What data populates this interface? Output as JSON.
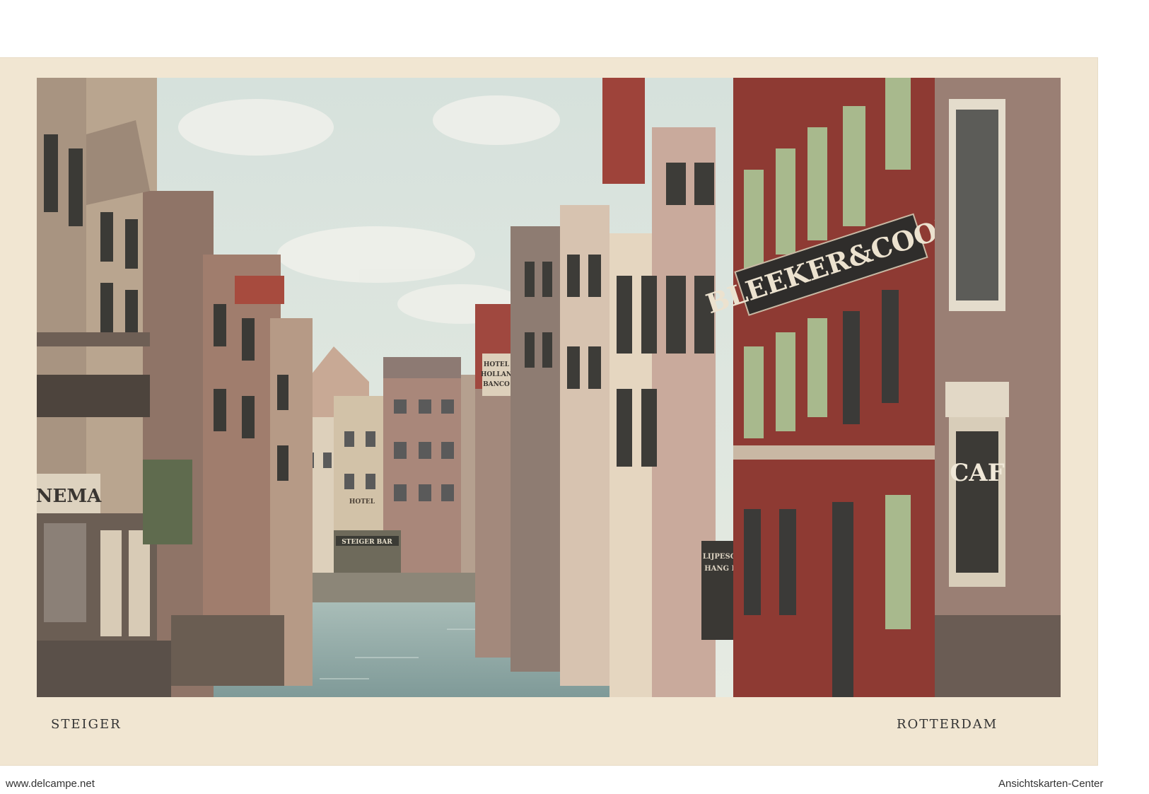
{
  "postcard": {
    "caption_left": "STEIGER",
    "caption_right": "ROTTERDAM",
    "signs": {
      "bleeker": "BLEEKER&COOL",
      "cinema": "NEMA",
      "cafe": "CAF",
      "steiger_bar": "STEIGER BAR",
      "hotel": "HOTEL",
      "shop_line1": "LIJPESCH",
      "shop_line2": "HANG IG",
      "hollandia_line1": "HOTEL",
      "hollandia_line2": "HOLLAN",
      "hollandia_line3": "BANCO"
    }
  },
  "watermarks": {
    "left": "www.delcampe.net",
    "right": "Ansichtskarten-Center"
  },
  "colors": {
    "card": "#f1e6d2",
    "sky": "#cfdcd6",
    "water": "#9fb5b2",
    "brick_red": "#8e3a33",
    "shutter_green": "#a8b98d"
  }
}
